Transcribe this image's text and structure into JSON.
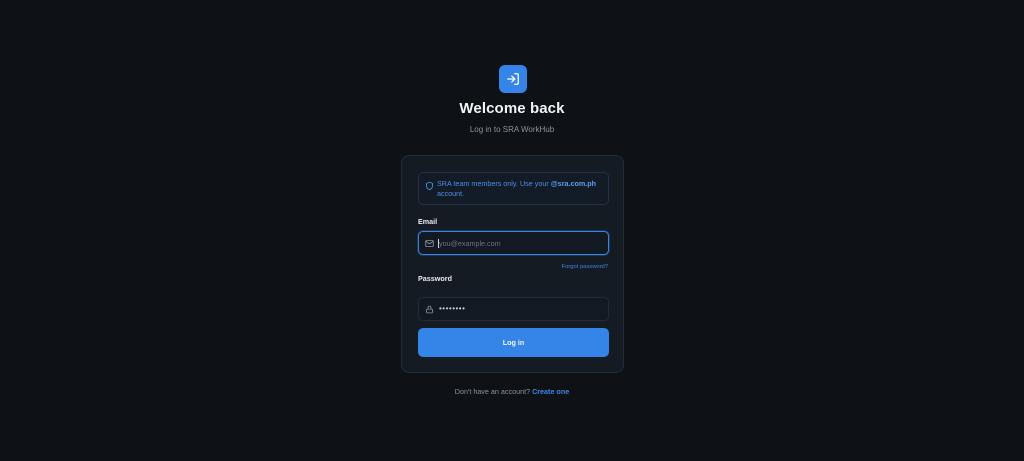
{
  "header": {
    "logo_icon": "login-icon",
    "title": "Welcome back",
    "subtitle": "Log in to SRA WorkHub"
  },
  "notice": {
    "icon": "shield-icon",
    "text_prefix": "SRA team members only. Use your ",
    "domain": "@sra.com.ph",
    "text_suffix": "account."
  },
  "form": {
    "email_label": "Email",
    "email_icon": "mail-icon",
    "email_placeholder": "you@example.com",
    "email_value": "",
    "forgot_label": "Forgot password?",
    "password_label": "Password",
    "password_icon": "lock-icon",
    "password_value": "••••••••",
    "submit_label": "Log in"
  },
  "footer": {
    "prompt": "Don't have an account?",
    "link": "Create one"
  },
  "colors": {
    "background": "#0e1217",
    "card": "#151b23",
    "accent": "#3584e8"
  }
}
